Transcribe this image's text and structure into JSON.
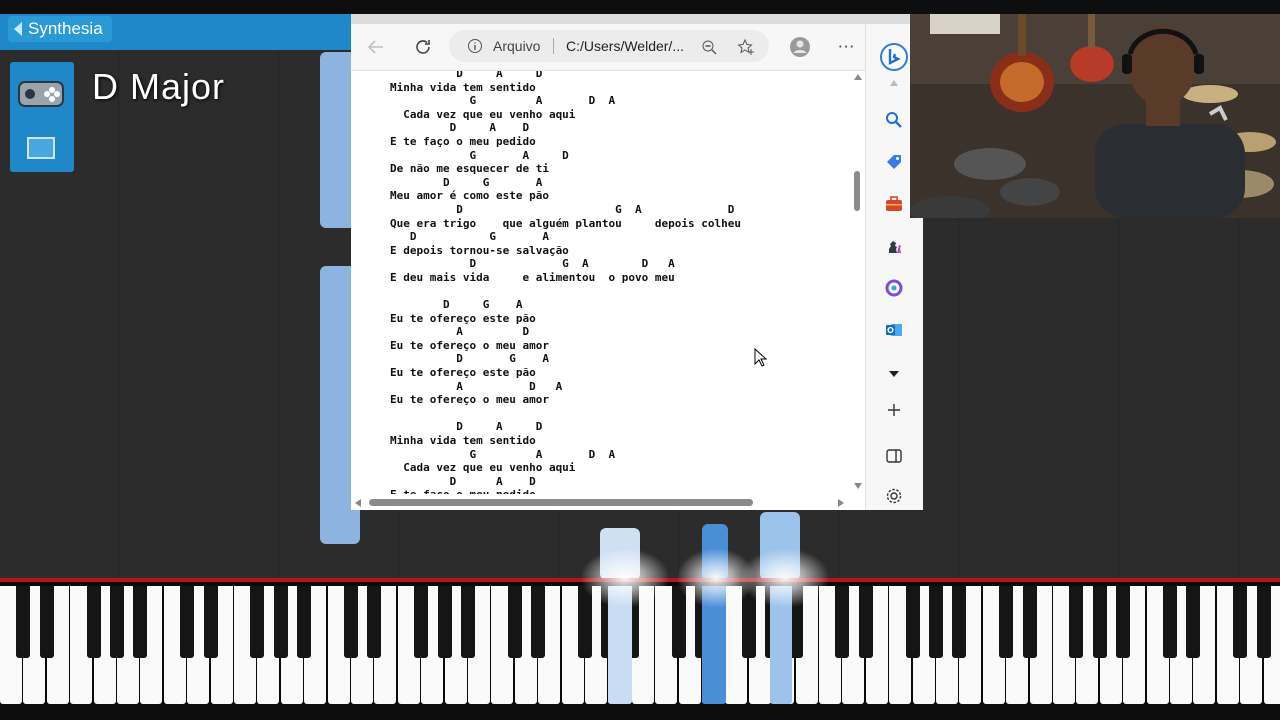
{
  "synthesia": {
    "app_label": "Synthesia",
    "key_signature": "D  Major"
  },
  "browser": {
    "omnibox_label": "Arquivo",
    "omnibox_url": "C:/Users/Welder/...",
    "icons": {
      "back": "arrow-left-icon",
      "reload": "reload-icon",
      "info": "info-icon",
      "zoom_out": "zoom-out-icon",
      "favorites": "add-favorite-icon",
      "profile": "profile-icon",
      "menu": "more-icon",
      "bing": "bing-icon"
    },
    "song_text": "          D     A     D\nMinha vida tem sentido\n            G         A       D  A\n  Cada vez que eu venho aqui\n         D     A    D\nE te faço o meu pedido\n            G       A     D\nDe não me esquecer de ti\n        D     G       A\nMeu amor é como este pão\n          D                       G  A             D\nQue era trigo    que alguém plantou     depois colheu\n   D           G       A\nE depois tornou-se salvação\n            D             G  A        D   A\nE deu mais vida     e alimentou  o povo meu\n\n        D     G    A\nEu te ofereço este pão\n          A         D\nEu te ofereço o meu amor\n          D       G    A\nEu te ofereço este pão\n          A          D   A\nEu te ofereço o meu amor\n\n          D     A     D\nMinha vida tem sentido\n            G         A       D  A\n  Cada vez que eu venho aqui\n         D      A    D\nE te faço o meu pedido"
  },
  "sidebar_icons": [
    "search-icon",
    "tag-icon",
    "briefcase-icon",
    "chess-icon",
    "office-icon",
    "outlook-icon",
    "chevron-down-icon",
    "plus-icon",
    "split-screen-icon",
    "settings-icon"
  ],
  "colors": {
    "synthesia_blue": "#1e88c8",
    "note_blue": "#8db4e0",
    "background": "#2c2c2c"
  }
}
